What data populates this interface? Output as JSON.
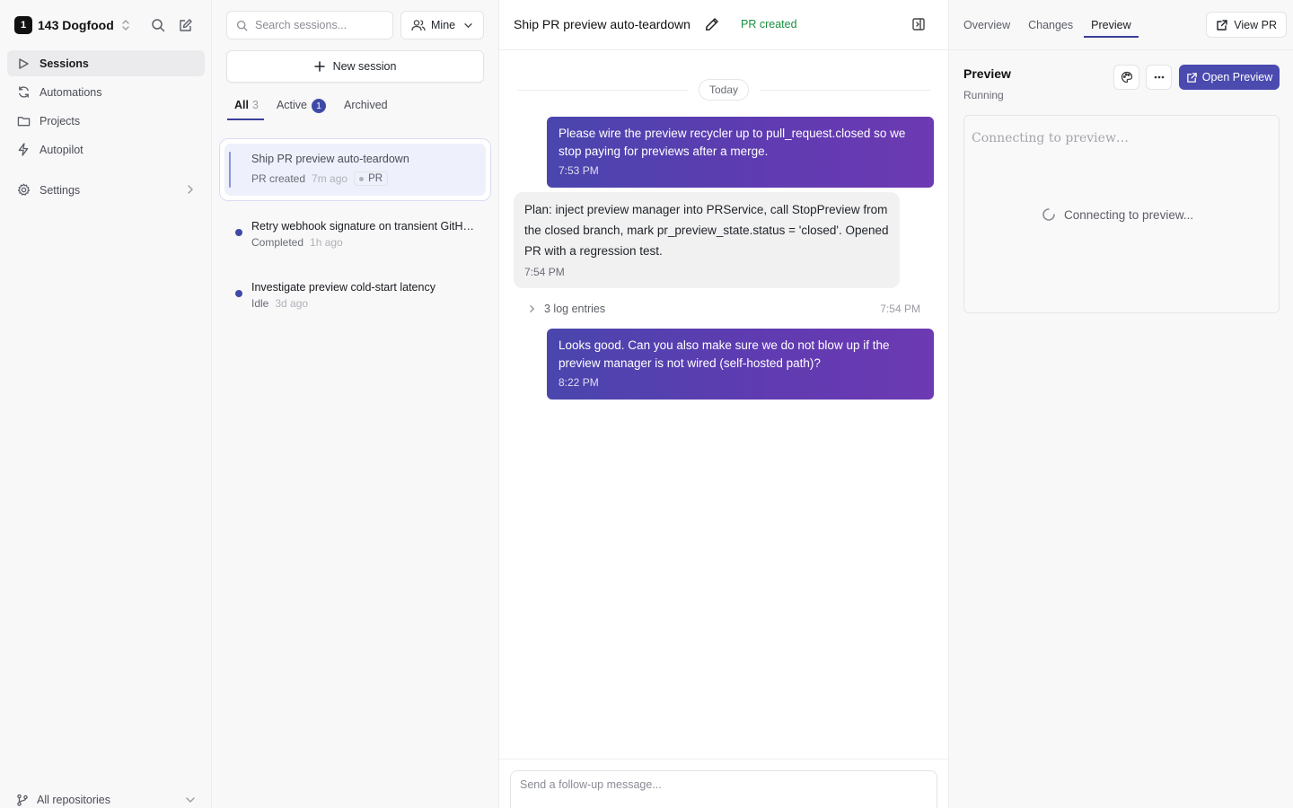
{
  "workspace": {
    "badge": "1",
    "name": "143 Dogfood"
  },
  "sidebar": {
    "items": [
      {
        "label": "Sessions",
        "icon": "play-icon"
      },
      {
        "label": "Automations",
        "icon": "refresh-icon"
      },
      {
        "label": "Projects",
        "icon": "folder-icon"
      },
      {
        "label": "Autopilot",
        "icon": "bolt-icon"
      }
    ],
    "settings_label": "Settings",
    "repo_label": "All repositories"
  },
  "list": {
    "search_placeholder": "Search sessions...",
    "filter_label": "Mine",
    "new_session_label": "New session",
    "tabs": [
      {
        "label": "All",
        "count": "3"
      },
      {
        "label": "Active",
        "count": "1"
      },
      {
        "label": "Archived"
      }
    ],
    "sessions": [
      {
        "title": "Ship PR preview auto-teardown",
        "status": "PR created",
        "ago": "7m ago",
        "chip": "PR"
      },
      {
        "title": "Retry webhook signature on transient GitHub errors",
        "status": "Completed",
        "ago": "1h ago"
      },
      {
        "title": "Investigate preview cold-start latency",
        "status": "Idle",
        "ago": "3d ago"
      }
    ]
  },
  "chat": {
    "title": "Ship PR preview auto-teardown",
    "status": "PR created",
    "date_divider": "Today",
    "messages": [
      {
        "text": "Please wire the preview recycler up to pull_request.closed so we stop paying for previews after a merge.",
        "time": "7:53 PM"
      },
      {
        "text": "Plan: inject preview manager into PRService, call StopPreview from the closed branch, mark pr_preview_state.status = 'closed'. Opened PR with a regression test.",
        "time": "7:54 PM"
      },
      {
        "text": "Looks good. Can you also make sure we do not blow up if the preview manager is not wired (self-hosted path)?",
        "time": "8:22 PM"
      }
    ],
    "log": {
      "label": "3 log entries",
      "time": "7:54 PM"
    },
    "composer_placeholder": "Send a follow-up message..."
  },
  "right": {
    "tabs": [
      "Overview",
      "Changes",
      "Preview"
    ],
    "active_tab": "Preview",
    "view_pr_label": "View PR",
    "preview_title": "Preview",
    "preview_status": "Running",
    "open_preview_label": "Open Preview",
    "iframe_text": "Connecting to preview…",
    "loading_text": "Connecting to preview..."
  },
  "colors": {
    "accent": "#4a4aaf",
    "success": "#1a8f3f",
    "user_bubble_start": "#4a46ae",
    "user_bubble_end": "#6c3ab2"
  }
}
